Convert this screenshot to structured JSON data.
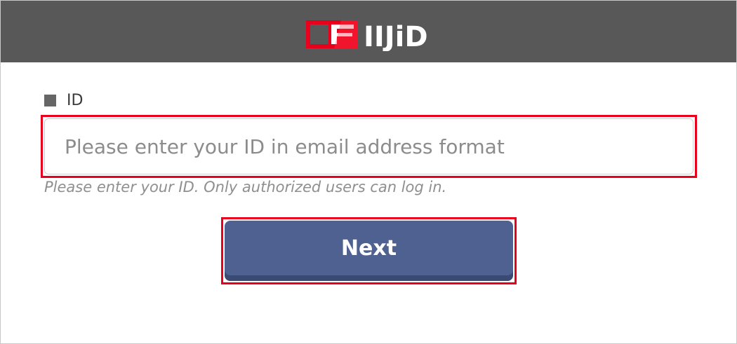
{
  "header": {
    "logo_text": "IIJiD",
    "logo_icon": "iijid-logo-icon",
    "background_color": "#585858",
    "brand_color": "#e8001c"
  },
  "form": {
    "id_label": "ID",
    "id_input": {
      "value": "",
      "placeholder": "Please enter your ID in email address format"
    },
    "hint": "Please enter your ID. Only authorized users can log in.",
    "next_label": "Next",
    "button_color": "#4f6190"
  },
  "annotations": {
    "highlight_color": "#e8001c"
  }
}
